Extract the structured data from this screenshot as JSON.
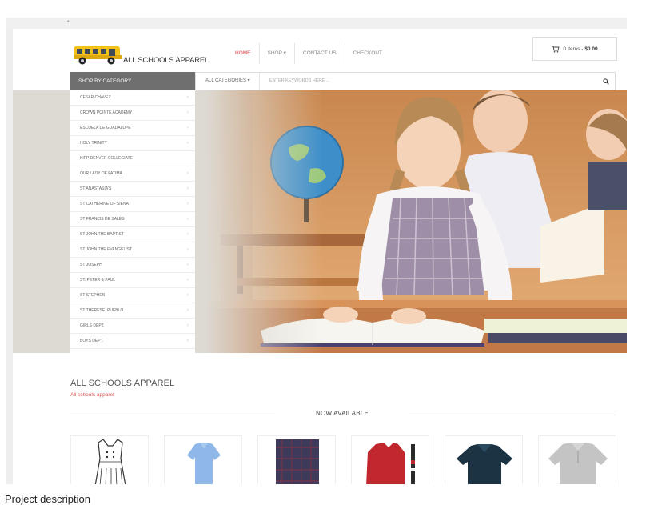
{
  "topbar": {
    "left_text": "",
    "right_text": ""
  },
  "header": {
    "logo_text": "ALL SCHOOLS APPAREL",
    "nav": [
      "HOME",
      "SHOP ▾",
      "CONTACT US",
      "CHECKOUT"
    ],
    "cart_label": "0 items -",
    "cart_total": "$0.00"
  },
  "search": {
    "category_heading": "SHOP BY CATEGORY",
    "all_categories": "ALL CATEGORIES ▾",
    "placeholder": "ENTER KEYWORDS HERE ..."
  },
  "sidebar": {
    "items": [
      "CESAR CHAVEZ",
      "CROWN POINTE ACADEMY",
      "ESCUELA DE GUADALUPE",
      "HOLY TRINITY",
      "KIPP DENVER COLLEGIATE",
      "OUR LADY OF FATIMA",
      "ST ANASTASIA'S",
      "ST CATHERINE OF SIENA",
      "ST FRANCIS DE SALES",
      "ST JOHN THE BAPTIST",
      "ST JOHN THE EVANGELIST",
      "ST JOSEPH",
      "ST. PETER & PAUL",
      "ST STEPHEN",
      "ST THERESE, PUEBLO",
      "GIRLS DEPT.",
      "BOYS DEPT."
    ]
  },
  "section": {
    "title": "ALL SCHOOLS APPAREL",
    "subtitle": "All schools apparel",
    "now_available": "NOW AVAILABLE"
  },
  "products": [
    {
      "icon": "jumper-dress-icon",
      "color": "#ffffff"
    },
    {
      "icon": "polo-shirt-icon",
      "color": "#8fb8e8"
    },
    {
      "icon": "plaid-skirt-icon",
      "color": "#3d3a5c"
    },
    {
      "icon": "sweater-icon",
      "color": "#c0282d"
    },
    {
      "icon": "polo-shirt-icon",
      "color": "#1c3344"
    },
    {
      "icon": "polo-shirt-icon",
      "color": "#c4c4c4"
    }
  ],
  "caption": "Project description",
  "colors": {
    "accent": "#d94a4a",
    "category_bar": "#6f6f6f"
  }
}
